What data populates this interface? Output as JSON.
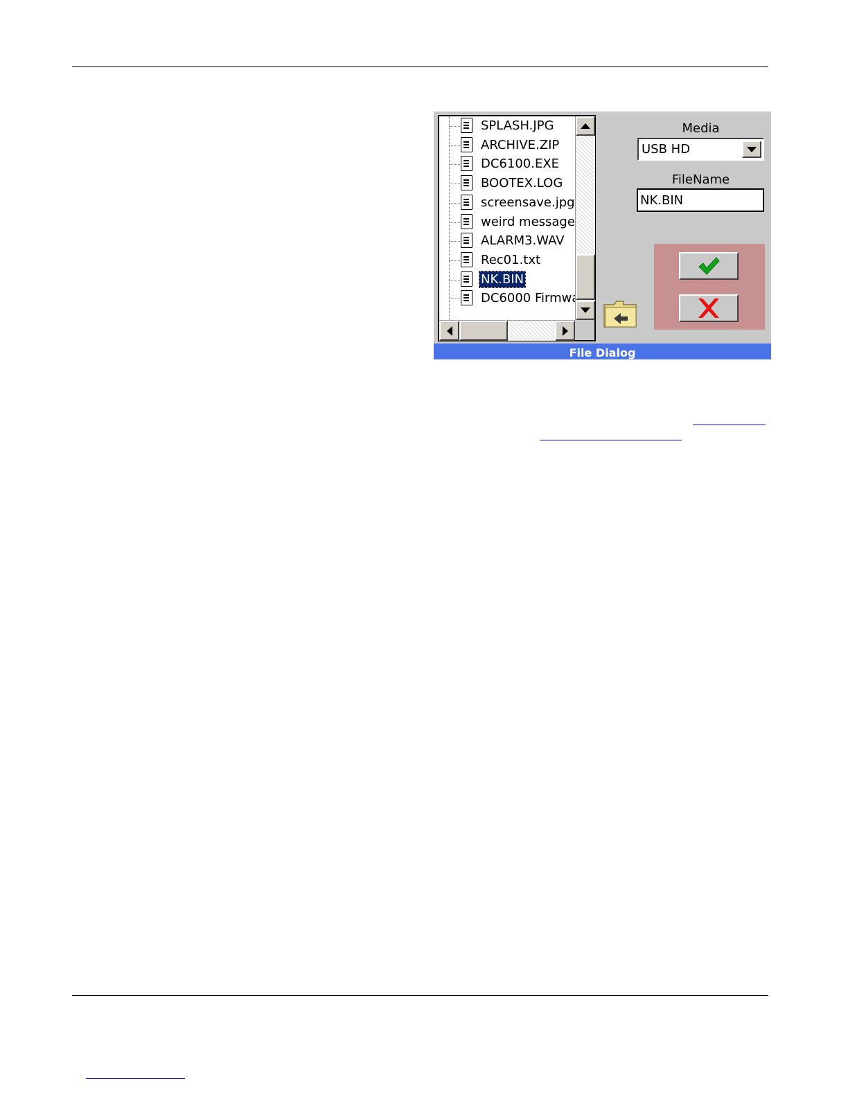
{
  "dialog": {
    "title": "File Dialog",
    "files": [
      {
        "name": "SPLASH.JPG",
        "selected": false
      },
      {
        "name": "ARCHIVE.ZIP",
        "selected": false
      },
      {
        "name": "DC6100.EXE",
        "selected": false
      },
      {
        "name": "BOOTEX.LOG",
        "selected": false
      },
      {
        "name": "screensave.jpg",
        "selected": false
      },
      {
        "name": "weird message.",
        "selected": false
      },
      {
        "name": "ALARM3.WAV",
        "selected": false
      },
      {
        "name": "Rec01.txt",
        "selected": false
      },
      {
        "name": "NK.BIN",
        "selected": true
      },
      {
        "name": "DC6000 Firmwa",
        "selected": false
      }
    ],
    "media": {
      "label": "Media",
      "value": "USB HD"
    },
    "filename": {
      "label": "FileName",
      "value": "NK.BIN"
    },
    "icons": {
      "file": "document-icon",
      "up_folder": "folder-up-icon",
      "ok": "checkmark-icon",
      "cancel": "x-cross-icon"
    },
    "colors": {
      "titlebar": "#4a73e8",
      "background": "#c9c9c9",
      "action_panel": "#c79191",
      "selection": "#0a246a",
      "ok_icon": "#11a51a",
      "cancel_icon": "#e81010"
    }
  }
}
